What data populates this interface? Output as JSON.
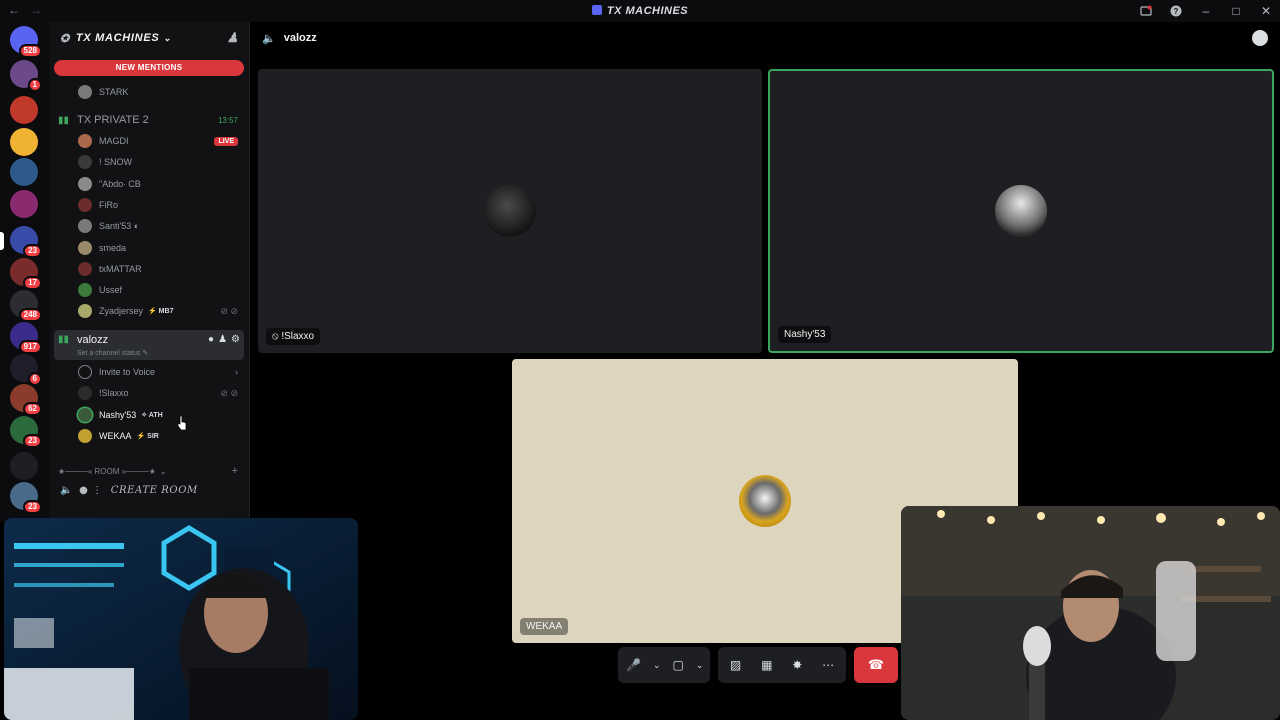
{
  "window": {
    "title": "TX MACHINES"
  },
  "rail": {
    "servers": [
      {
        "name": "discord-home",
        "badge": "528",
        "color": "#5865f2"
      },
      {
        "name": "server-purple",
        "badge": "1",
        "color": "#6c4a8a"
      },
      {
        "name": "server-arc",
        "badge": "",
        "color": "#c0392b"
      },
      {
        "name": "server-53",
        "badge": "",
        "color": "#f0b232"
      },
      {
        "name": "server-gang",
        "badge": "",
        "color": "#2d5a8a"
      },
      {
        "name": "server-pink",
        "badge": "",
        "color": "#8a2b6f"
      },
      {
        "name": "server-tx",
        "badge": "23",
        "color": "#3a4aa8"
      },
      {
        "name": "server-crest",
        "badge": "17",
        "color": "#7a2b2b"
      },
      {
        "name": "server-at",
        "badge": "248",
        "color": "#2b2d31"
      },
      {
        "name": "server-blue",
        "badge": "917",
        "color": "#3b2b8a"
      },
      {
        "name": "server-c",
        "badge": "6",
        "color": "#1f1f2b"
      },
      {
        "name": "server-face",
        "badge": "62",
        "color": "#8a3b2b"
      },
      {
        "name": "server-green",
        "badge": "23",
        "color": "#2b6a3b"
      },
      {
        "name": "server-folder",
        "badge": "",
        "color": "#1e1f22"
      },
      {
        "name": "server-avatar",
        "badge": "23",
        "color": "#4a6a8a"
      }
    ]
  },
  "sidebar": {
    "guild_name": "TX MACHINES",
    "new_mentions": "NEW MENTIONS",
    "top_user": "STARK",
    "private_channel": {
      "name": "TX PRIVATE 2",
      "time": "13:57"
    },
    "private_users": [
      {
        "name": "MAGDI",
        "live": "LIVE",
        "color": "#a86a4a"
      },
      {
        "name": "! SNOW",
        "color": "#3a3a3a"
      },
      {
        "name": "\"Abdo∙ CB",
        "color": "#8a8a8a"
      },
      {
        "name": "FiRo",
        "color": "#6a2b2b"
      },
      {
        "name": "Santi'53 ◐",
        "color": "#7a7a7a"
      },
      {
        "name": "smeda",
        "color": "#9a8a6a"
      },
      {
        "name": "txMATTAR",
        "color": "#6a2b2b"
      },
      {
        "name": "Ussef",
        "color": "#3b7a3b"
      },
      {
        "name": "Zyadjersey",
        "tag": "⚡ MB7",
        "color": "#a8a86a"
      }
    ],
    "voice_channel": {
      "name": "valozz",
      "status": "Set a channel status ✎"
    },
    "invite": "Invite to Voice",
    "voice_users": [
      {
        "name": "!Slaxxo",
        "tag": "",
        "color": "#2b2b2b"
      },
      {
        "name": "Nashy'53",
        "tag": "✧ ATH",
        "color": "#3a5a3a"
      },
      {
        "name": "WEKAA",
        "tag": "⚡ SIR",
        "color": "#c0a030"
      }
    ],
    "room_header": "★────« ROOM »────★",
    "create_room": "CREATE ROOM"
  },
  "content": {
    "channel_title": "valozz",
    "tiles": [
      {
        "name": "!Slaxxo",
        "prefix": "⦸ "
      },
      {
        "name": "Nashy'53"
      },
      {
        "name": "WEKAA"
      }
    ]
  },
  "colors": {
    "accent": "#5865f2",
    "danger": "#da373c",
    "speaking": "#3ba55c",
    "tile_bg": "#1e1f22",
    "stage_bg": "#ddd5bd"
  }
}
